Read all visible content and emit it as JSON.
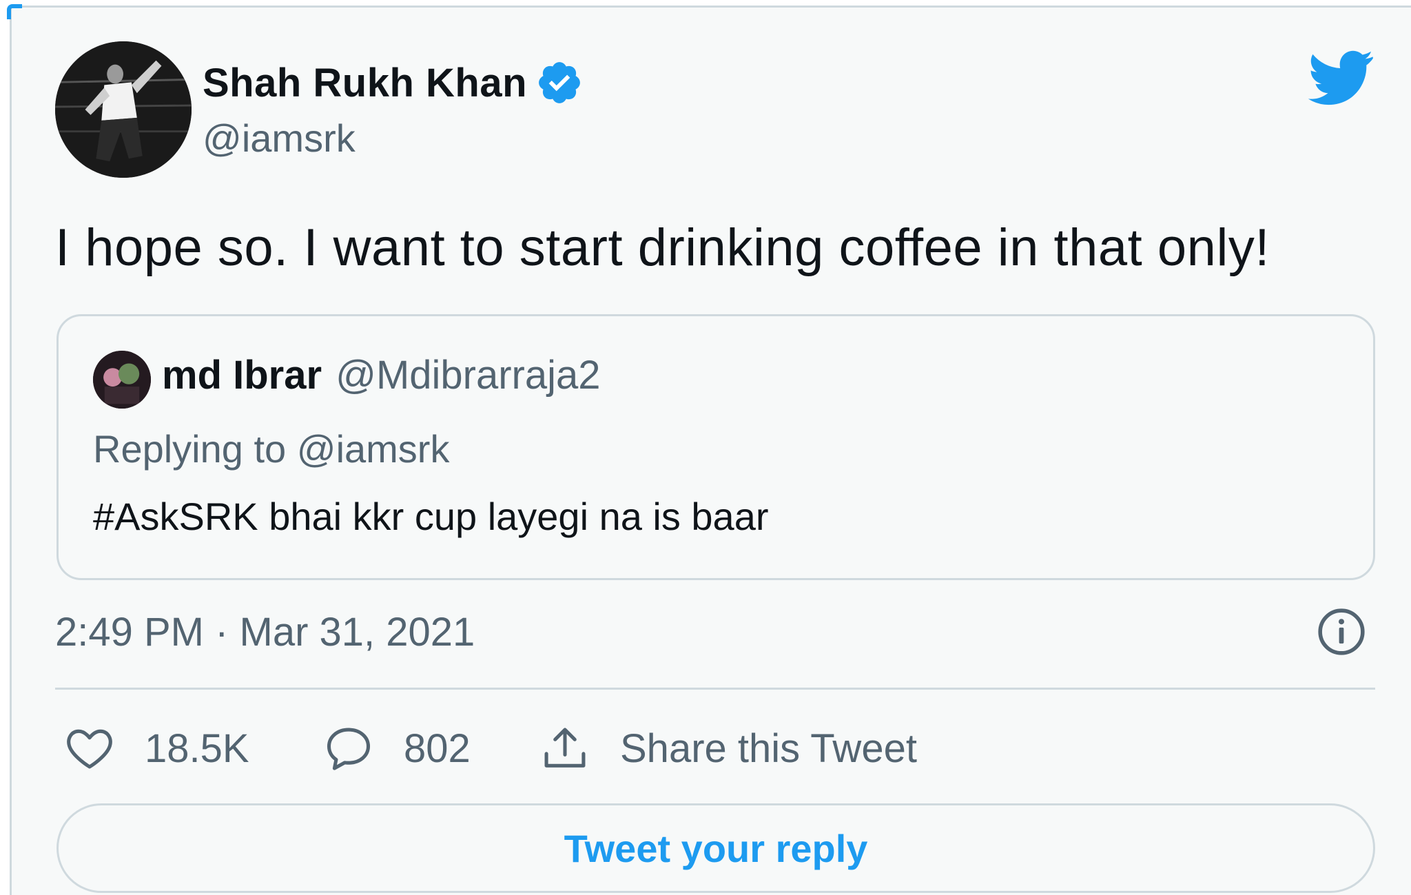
{
  "author": {
    "display_name": "Shah Rukh Khan",
    "handle": "@iamsrk",
    "verified": true
  },
  "tweet": {
    "text": "I hope so. I want to start drinking coffee in that only!",
    "timestamp": "2:49 PM · Mar 31, 2021"
  },
  "quoted_tweet": {
    "display_name": "md Ibrar",
    "handle": "@Mdibrarraja2",
    "replying_to": "Replying to @iamsrk",
    "text": "#AskSRK bhai kkr cup layegi na is baar"
  },
  "actions": {
    "like_count": "18.5K",
    "reply_count": "802",
    "share_label": "Share this Tweet"
  },
  "reply_button_label": "Tweet your reply",
  "icons": {
    "brand": "twitter-bird-icon",
    "verified": "verified-badge-icon",
    "info": "info-icon",
    "like": "heart-icon",
    "reply": "speech-bubble-icon",
    "share": "share-upload-icon"
  },
  "colors": {
    "brand_blue": "#1d9bf0",
    "text_primary": "#0f1419",
    "text_secondary": "#536471",
    "border": "#cfd9de",
    "background": "#f7f9f9"
  }
}
